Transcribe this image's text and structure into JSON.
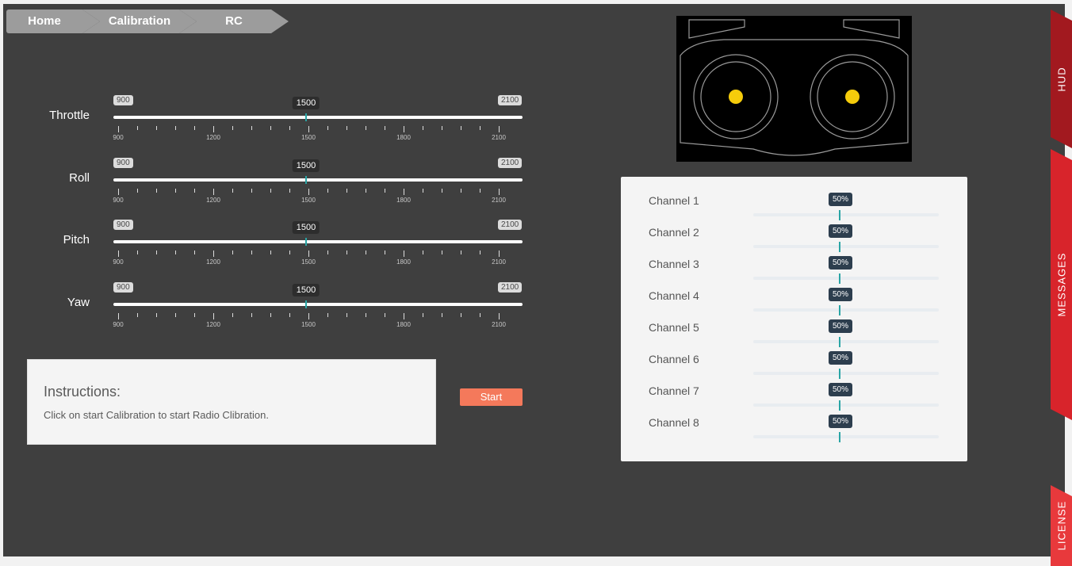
{
  "breadcrumb": [
    "Home",
    "Calibration",
    "RC"
  ],
  "sliders": [
    {
      "label": "Throttle",
      "min": "900",
      "max": "2100",
      "value": "1500"
    },
    {
      "label": "Roll",
      "min": "900",
      "max": "2100",
      "value": "1500"
    },
    {
      "label": "Pitch",
      "min": "900",
      "max": "2100",
      "value": "1500"
    },
    {
      "label": "Yaw",
      "min": "900",
      "max": "2100",
      "value": "1500"
    }
  ],
  "tick_labels": [
    "900",
    "1200",
    "1500",
    "1800",
    "2100"
  ],
  "instructions": {
    "title": "Instructions:",
    "text": "Click on start Calibration to start Radio Clibration."
  },
  "start_button": "Start",
  "channels": [
    {
      "label": "Channel 1",
      "value": "50%"
    },
    {
      "label": "Channel 2",
      "value": "50%"
    },
    {
      "label": "Channel 3",
      "value": "50%"
    },
    {
      "label": "Channel 4",
      "value": "50%"
    },
    {
      "label": "Channel 5",
      "value": "50%"
    },
    {
      "label": "Channel 6",
      "value": "50%"
    },
    {
      "label": "Channel 7",
      "value": "50%"
    },
    {
      "label": "Channel 8",
      "value": "50%"
    }
  ],
  "side_tabs": {
    "hud": "HUD",
    "messages": "MESSAGES",
    "license": "LICENSE"
  },
  "colors": {
    "accent": "#2aa5a5",
    "start": "#f4795b",
    "stick": "#f5cc0b"
  }
}
